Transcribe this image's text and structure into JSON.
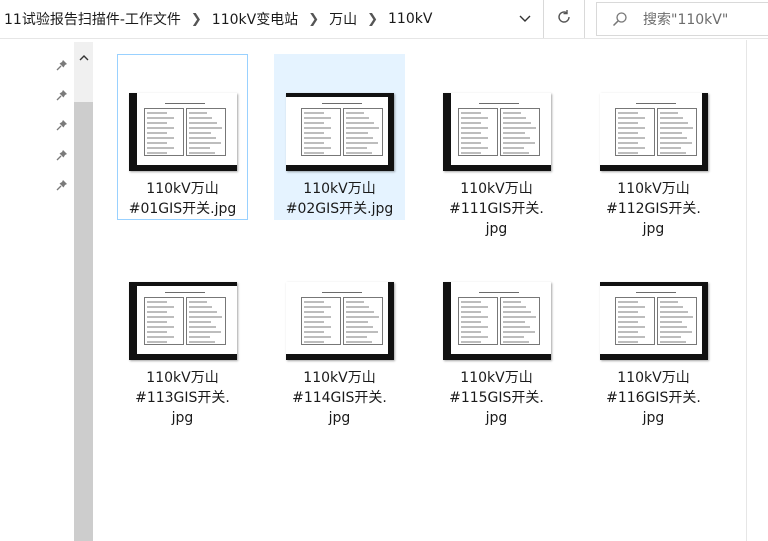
{
  "address_bar": {
    "crumbs": [
      "11试验报告扫描件-工作文件",
      "110kV变电站",
      "万山",
      "110kV"
    ]
  },
  "search": {
    "placeholder": "搜索\"110kV\""
  },
  "files": [
    {
      "line1": "110kV万山",
      "line2": "#01GIS开关.jpg",
      "line3": "",
      "state": "focused"
    },
    {
      "line1": "110kV万山",
      "line2": "#02GIS开关.jpg",
      "line3": "",
      "state": "selected"
    },
    {
      "line1": "110kV万山",
      "line2": "#111GIS开关.",
      "line3": "jpg",
      "state": "normal"
    },
    {
      "line1": "110kV万山",
      "line2": "#112GIS开关.",
      "line3": "jpg",
      "state": "normal"
    },
    {
      "line1": "110kV万山",
      "line2": "#113GIS开关.",
      "line3": "jpg",
      "state": "normal"
    },
    {
      "line1": "110kV万山",
      "line2": "#114GIS开关.",
      "line3": "jpg",
      "state": "normal"
    },
    {
      "line1": "110kV万山",
      "line2": "#115GIS开关.",
      "line3": "jpg",
      "state": "normal"
    },
    {
      "line1": "110kV万山",
      "line2": "#116GIS开关.",
      "line3": "jpg",
      "state": "normal"
    }
  ],
  "icons": {
    "address_dropdown": "chevron-down-icon",
    "refresh": "refresh-icon",
    "search": "search-icon",
    "nav_pin": "pin-icon",
    "scroll_up": "chevron-up-icon"
  },
  "colors": {
    "selected_bg": "#e5f3ff",
    "focus_border": "#99d1ff"
  }
}
